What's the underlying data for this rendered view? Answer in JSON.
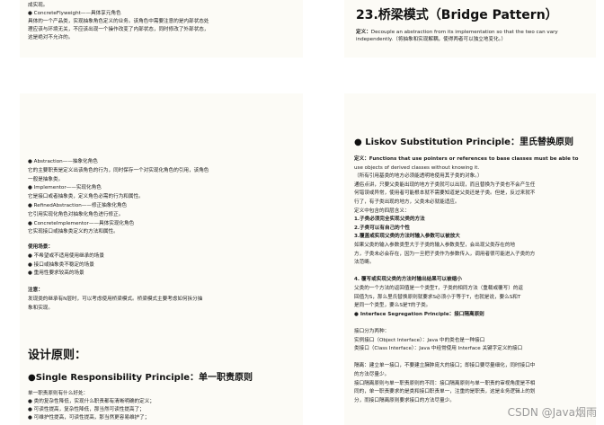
{
  "tl": {
    "lines": [
      "成实现。",
      "● ConcreteFlyweight——具体享元角色",
      "具体的一个产品类，实现抽象角色定义的业务。该角色中需要注意的是内部状态处",
      "理应该与环境无关，不应该出现一个操作改变了内部状态，同时修改了外部状态，",
      "这是绝对不允许的。"
    ]
  },
  "tr": {
    "title": "23.桥梁模式（Bridge Pattern）",
    "def1_label": "定义：",
    "def1": "Decouple an abstraction from its implementation so that the two can vary",
    "def2": "independently.（将抽象和实现解耦，使得两者可以独立地变化。）"
  },
  "ml": {
    "lines": [
      "● Abstraction——抽象化角色",
      "它的主要职责是定义出该角色的行为，同时保存一个对实现化角色的引用，该角色",
      "一般是抽象类。",
      "● Implementor——实现化角色",
      "它是接口或者抽象类，定义角色必需的行为和属性。",
      "● RefinedAbstraction——修正抽象化角色",
      "它引用实现化角色对抽象化角色进行修正。",
      "● ConcreteImplementor——具体实现化角色",
      "它实现接口或抽象类定义的方法和属性。"
    ],
    "scene_title": "使用场景：",
    "scene": [
      "● 不希望或不适用使用继承的场景",
      "● 接口或抽象类不稳定的场景",
      "● 重用性要求较高的场景"
    ],
    "note_title": "注意：",
    "note": [
      "发现类的继承有N层时，可以考虑使用桥梁模式。桥梁模式主要考虑如何拆分抽",
      "象和实现。"
    ]
  },
  "bl": {
    "section": "设计原则：",
    "srp": "●Single Responsibility Principle：单一职责原则",
    "lines": [
      "单一职责原则有什么好处：",
      "● 类的复杂性降低，实现什么职责都有清晰明确的定义；",
      "● 可读性提高，复杂性降低，那当然可读性提高了；",
      "● 可维护性提高，可读性提高，那当然更容易维护了；"
    ]
  },
  "mr": {
    "lsp": "● Liskov Substitution Principle：里氏替换原则",
    "lines": [
      "定义：Functions that use pointers or references to base classes must be able to",
      "use objects of derived classes without knowing it.",
      "（所有引用基类的地方必须能透明地使用其子类的对象。）",
      "通俗点讲，只要父类能出现的地方子类就可以出现，而且替换为子类也不会产生任",
      "何错误或异常，使用者可能根本就不需要知道是父类还是子类。但是，反过来就不",
      "行了，有子类出现的地方，父类未必就能适应。",
      "定义中包含的四层含义：",
      "1.子类必须完全实现父类的方法",
      "2.子类可以有自己的个性",
      "3.覆盖或实现父类的方法时输入参数可以被放大",
      "    如果父类的输入参数类型大于子类的输入参数类型，会出现父类存在的地",
      "方，子类未必会存在，因为一旦把子类作为参数传入，调用者很可能进入子类的方",
      "法范畴。",
      "",
      "4. 覆写或实现父类的方法时输出结果可以被缩小",
      "    父类的一个方法的返回值是一个类型T，子类的相同方法（重载或覆写）的返",
      "回值为S，那么里氏替换原则就要求S必须小于等于T，也就是说，要么S和T",
      "是同一个类型，要么S是T的子类。",
      "● Interface Segregation Principle：接口隔离原则",
      "",
      "接口分为两种：",
      "实例接口（Object Interface）：Java 中的类也是一种接口",
      "类接口（Class Interface）：Java 中经常使用 Interface 关键字定义的接口",
      "",
      "隔离：建立单一接口，不要建立臃肿庞大的接口；即接口要尽量细化，同时接口中",
      "的方法尽量少。",
      "接口隔离原则与单一职责原则的不同：接口隔离原则与单一职责的审视角度是不相",
      "同的，单一职责要求的是类和接口职责单一，注重的是职责，这是业务逻辑上的划",
      "分，而接口隔离原则要求接口的方法尽量少。"
    ],
    "bold_lines": [
      0,
      7,
      8,
      9,
      14,
      18
    ]
  },
  "watermark": "CSDN @Java烟雨"
}
